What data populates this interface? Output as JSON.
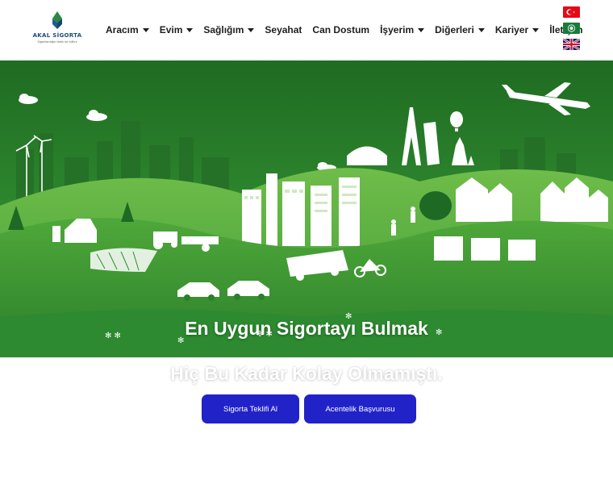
{
  "brand": {
    "name": "AKAL SİGORTA",
    "slogan": "Sigortacılığın farklı bir hâlini"
  },
  "nav": {
    "items": [
      {
        "label": "Aracım",
        "dropdown": true
      },
      {
        "label": "Evim",
        "dropdown": true
      },
      {
        "label": "Sağlığım",
        "dropdown": true
      },
      {
        "label": "Seyahat",
        "dropdown": false
      },
      {
        "label": "Can Dostum",
        "dropdown": false
      },
      {
        "label": "İşyerim",
        "dropdown": true
      },
      {
        "label": "Diğerleri",
        "dropdown": true
      },
      {
        "label": "Kariyer",
        "dropdown": true
      },
      {
        "label": "İletişim",
        "dropdown": false
      }
    ]
  },
  "languages": [
    {
      "name": "turkish-flag-icon"
    },
    {
      "name": "saudi-arabia-flag-icon"
    },
    {
      "name": "uk-flag-icon"
    }
  ],
  "hero": {
    "headline": "En Uygun Sigortayı Bulmak",
    "subheadline": "Hiç Bu Kadar Kolay Olmamıştı.",
    "buttons": {
      "quote": "Sigorta Teklifi Al",
      "agency": "Acentelik Başvurusu"
    }
  },
  "colors": {
    "primary_button": "#2222c9",
    "hero_green": "#2b7a2b"
  }
}
